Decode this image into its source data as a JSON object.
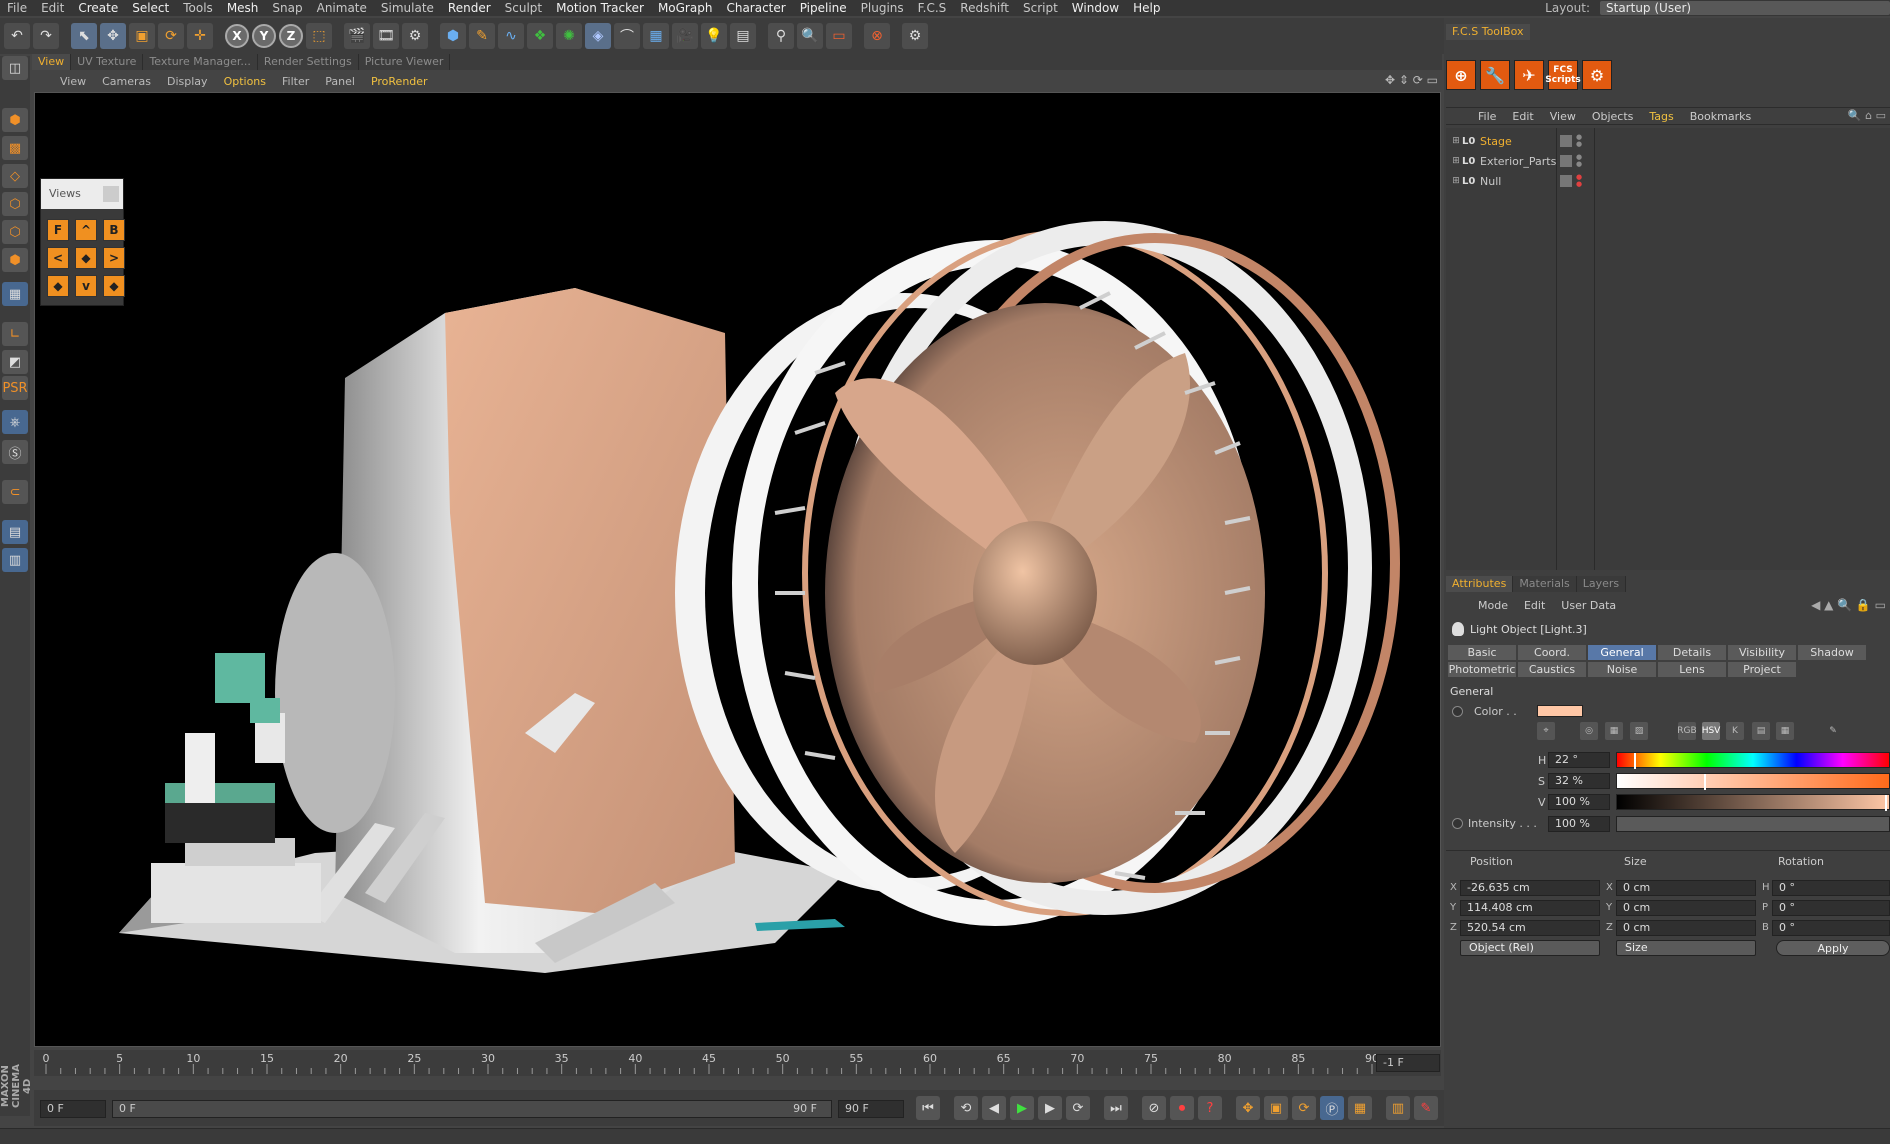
{
  "menubar": {
    "items": [
      "File",
      "Edit",
      "Create",
      "Select",
      "Tools",
      "Mesh",
      "Snap",
      "Animate",
      "Simulate",
      "Render",
      "Sculpt",
      "Motion Tracker",
      "MoGraph",
      "Character",
      "Pipeline",
      "Plugins",
      "F.C.S",
      "Redshift",
      "Script",
      "Window",
      "Help"
    ],
    "layout_label": "Layout:",
    "layout_value": "Startup (User)"
  },
  "toolbar": {
    "icons": [
      "undo-icon",
      "redo-icon",
      "live-select-icon",
      "move-icon",
      "scale-icon",
      "rotate-icon",
      "create-icon"
    ],
    "axis_x": "X",
    "axis_y": "Y",
    "axis_z": "Z"
  },
  "viewport": {
    "tabs": [
      "View",
      "UV Texture",
      "Texture Manager...",
      "Render Settings",
      "Picture Viewer"
    ],
    "active_tab": "View",
    "menu": [
      "View",
      "Cameras",
      "Display",
      "Options",
      "Filter",
      "Panel",
      "ProRender"
    ],
    "active_menu": "Options"
  },
  "views_widget": {
    "title": "Views",
    "buttons": [
      "F",
      "^",
      "B",
      "<",
      "◆",
      ">",
      "◆",
      "v",
      "◆"
    ]
  },
  "timeline": {
    "ticks": [
      "0",
      "5",
      "10",
      "15",
      "20",
      "25",
      "30",
      "35",
      "40",
      "45",
      "50",
      "55",
      "60",
      "65",
      "70",
      "75",
      "80",
      "85",
      "90"
    ],
    "current_frame": "-1 F",
    "start": "0 F",
    "range_start": "0 F",
    "range_end": "90 F",
    "end": "90 F"
  },
  "fcs": {
    "tab": "F.C.S ToolBox",
    "scripts_label": "FCS Scripts"
  },
  "object_manager": {
    "menu": [
      "File",
      "Edit",
      "View",
      "Objects",
      "Tags",
      "Bookmarks"
    ],
    "active_menu": "Tags",
    "objects": [
      {
        "name": "Stage",
        "color": "#f0b030"
      },
      {
        "name": "Exterior_Parts",
        "color": "#d0d0d0"
      },
      {
        "name": "Null",
        "color": "#d0d0d0"
      }
    ]
  },
  "attributes": {
    "tabs": [
      "Attributes",
      "Materials",
      "Layers"
    ],
    "active_tab": "Attributes",
    "menu": [
      "Mode",
      "Edit",
      "User Data"
    ],
    "object_title": "Light Object [Light.3]",
    "prop_tabs_row1": [
      "Basic",
      "Coord.",
      "General",
      "Details",
      "Visibility",
      "Shadow"
    ],
    "prop_tabs_row2": [
      "Photometric",
      "Caustics",
      "Noise",
      "Lens",
      "Project"
    ],
    "active_prop_tab": "General",
    "section": "General",
    "color_label": "Color . .",
    "color_value": "#ffc7a6",
    "color_modes": [
      "RGB",
      "HSV",
      "K"
    ],
    "h_label": "H",
    "h_value": "22 °",
    "h_frac": 0.061,
    "s_label": "S",
    "s_value": "32 %",
    "s_frac": 0.32,
    "v_label": "V",
    "v_value": "100 %",
    "v_frac": 1.0,
    "intensity_label": "Intensity . . .",
    "intensity_value": "100 %"
  },
  "coordinates": {
    "headers": [
      "Position",
      "Size",
      "Rotation"
    ],
    "rows": [
      {
        "axis": "X",
        "pos": "-26.635 cm",
        "size_axis": "X",
        "size": "0 cm",
        "rot_axis": "H",
        "rot": "0 °"
      },
      {
        "axis": "Y",
        "pos": "114.408 cm",
        "size_axis": "Y",
        "size": "0 cm",
        "rot_axis": "P",
        "rot": "0 °"
      },
      {
        "axis": "Z",
        "pos": "520.54 cm",
        "size_axis": "Z",
        "size": "0 cm",
        "rot_axis": "B",
        "rot": "0 °"
      }
    ],
    "mode_select": "Object (Rel)",
    "size_select": "Size",
    "apply": "Apply"
  },
  "branding": "MAXON CINEMA 4D"
}
